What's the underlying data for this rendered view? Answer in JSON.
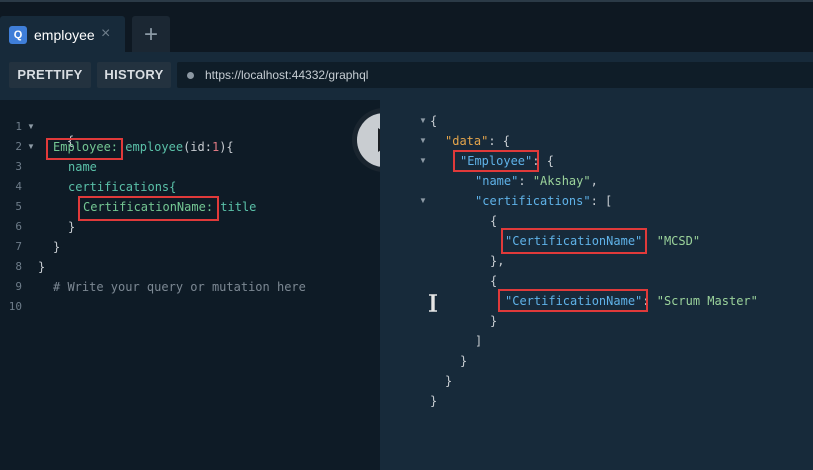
{
  "tabs": [
    {
      "label": "employee",
      "logo": "Q",
      "close_glyph": "×",
      "icon": "graphql-logo-icon"
    }
  ],
  "add_tab_glyph": "+",
  "toolbar": {
    "prettify_label": "PRETTIFY",
    "history_label": "HISTORY",
    "endpoint_url": "https://localhost:44332/graphql"
  },
  "editor": {
    "line_numbers": [
      "1",
      "2",
      "3",
      "4",
      "5",
      "6",
      "7",
      "8",
      "9",
      "10"
    ],
    "lines": {
      "l1": "{",
      "l2_alias": "Employee:",
      "l2_field": "employee",
      "l2_arg_open": "(id:",
      "l2_arg_val": "1",
      "l2_close": "){",
      "l3": "name",
      "l4": "certifications{",
      "l5_alias": "CertificationName:",
      "l5_field": "title",
      "l6": "}",
      "l7": "}",
      "l8": "}",
      "l9": "# Write your query or mutation here"
    }
  },
  "result": {
    "r1": "{",
    "r2_key": "\"data\"",
    "r2_rest": ": {",
    "r3_key": "\"Employee\"",
    "r3_rest": ": {",
    "r4_key": "\"name\"",
    "r4_colon": ": ",
    "r4_val": "\"Akshay\"",
    "r4_comma": ",",
    "r5_key": "\"certifications\"",
    "r5_rest": ": [",
    "r6": "{",
    "r7_key": "\"CertificationName\"",
    "r7_colon": ": ",
    "r7_val": "\"MCSD\"",
    "r8": "},",
    "r9": "{",
    "r10_key": "\"CertificationName\"",
    "r10_colon": ": ",
    "r10_val": "\"Scrum Master\"",
    "r11": "}",
    "r12": "]",
    "r13": "}",
    "r14": "}",
    "r15": "}"
  },
  "colors": {
    "highlight_box": "#e03a3a",
    "accent_logo": "#3f7ed8"
  }
}
